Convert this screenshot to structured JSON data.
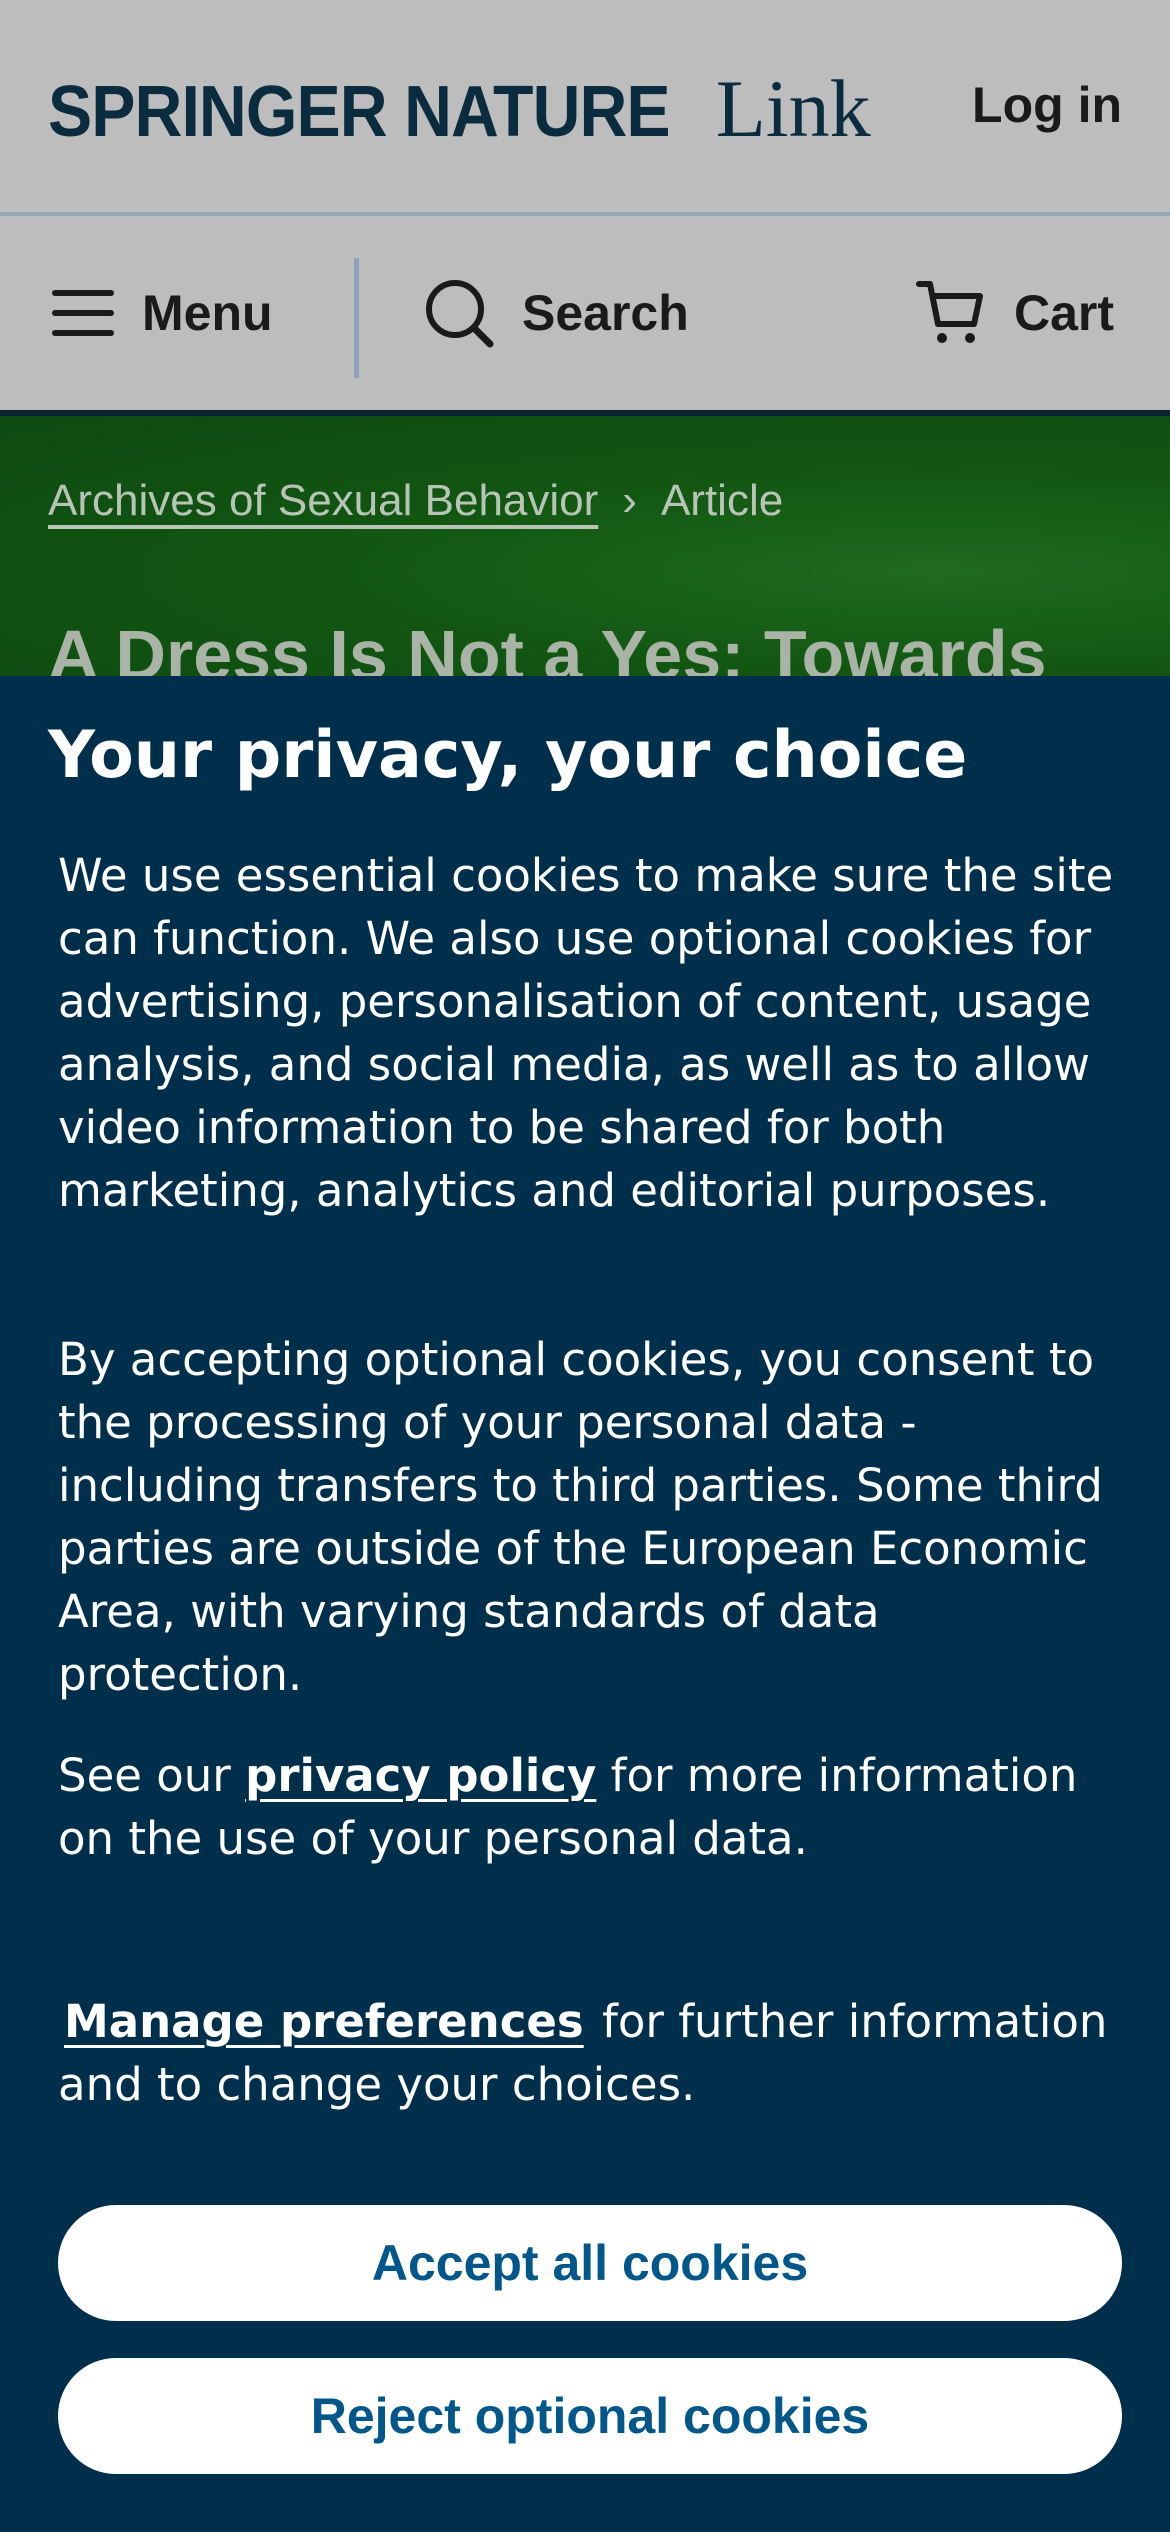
{
  "header": {
    "brand_name": "SPRINGER NATURE",
    "brand_link": "Link",
    "login_label": "Log in"
  },
  "nav": {
    "menu_label": "Menu",
    "search_label": "Search",
    "cart_label": "Cart",
    "icons": [
      "hamburger-menu-icon",
      "search-icon",
      "cart-icon"
    ]
  },
  "breadcrumb": {
    "journal": "Archives of Sexual Behavior",
    "current": "Article"
  },
  "article": {
    "title": "A Dress Is Not a Yes: Towards"
  },
  "consent": {
    "title": "Your privacy, your choice",
    "paragraph1": "We use essential cookies to make sure the site can function. We also use optional cookies for advertising, personalisation of content, usage analysis, and social media, as well as to allow video information to be shared for both marketing, analytics and editorial purposes.",
    "paragraph2": "By accepting optional cookies, you consent to the processing of your personal data - including transfers to third parties. Some third parties are outside of the European Economic Area, with varying standards of data protection.",
    "privacy_prefix": "See our",
    "privacy_link": "privacy policy",
    "privacy_suffix": "for more information on the use of your personal data.",
    "manage_link": "Manage preferences",
    "manage_suffix": "for further information and to change your choices.",
    "accept_label": "Accept all cookies",
    "reject_label": "Reject optional cookies"
  },
  "colors": {
    "header_bg": "#bdbdbd",
    "brand_navy": "#0b2b3f",
    "hero_green": "#125612",
    "consent_bg": "#002f4b",
    "button_text": "#01578a"
  }
}
